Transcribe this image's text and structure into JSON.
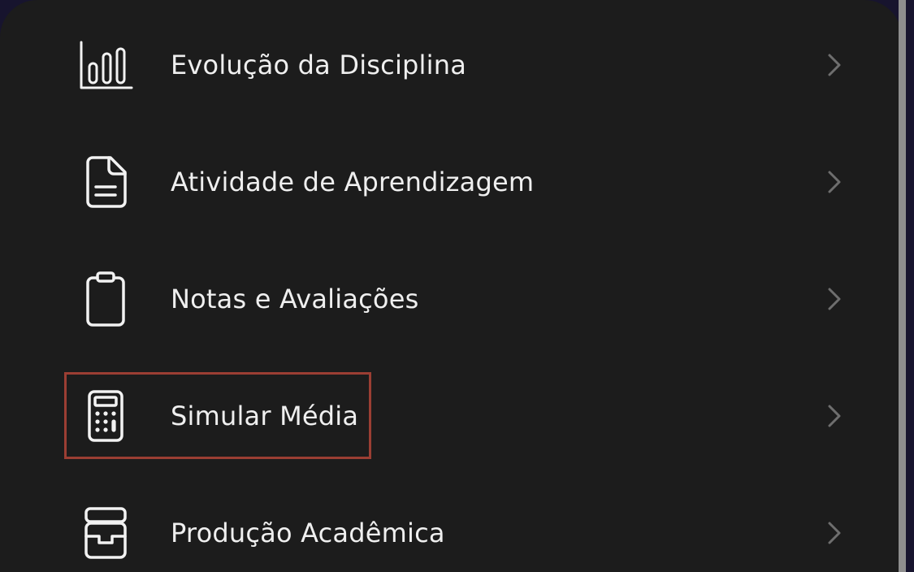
{
  "menu": {
    "items": [
      {
        "label": "Evolução da Disciplina",
        "icon": "bar-chart-icon"
      },
      {
        "label": "Atividade de Aprendizagem",
        "icon": "document-icon"
      },
      {
        "label": "Notas e Avaliações",
        "icon": "clipboard-icon"
      },
      {
        "label": "Simular Média",
        "icon": "calculator-icon",
        "highlighted": true
      },
      {
        "label": "Produção Acadêmica",
        "icon": "inbox-tray-icon"
      }
    ]
  },
  "colors": {
    "background": "#1c1c1c",
    "text": "#efefef",
    "chevron": "#6e6e6e",
    "highlight_border": "#9b3e33"
  }
}
